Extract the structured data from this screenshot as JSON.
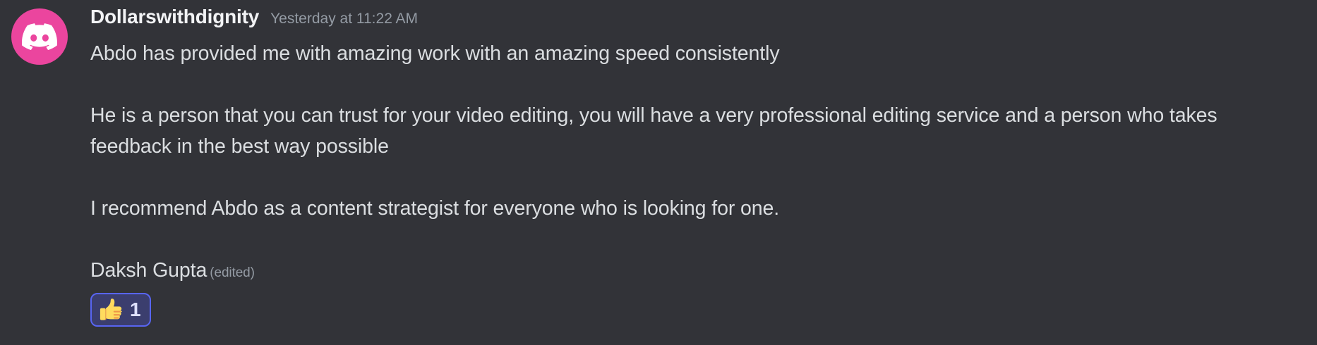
{
  "message": {
    "author": "Dollarswithdignity",
    "timestamp": "Yesterday at 11:22 AM",
    "avatar_icon": "discord-logo-icon",
    "avatar_color": "#eb459e",
    "paragraphs": [
      "Abdo has provided me with amazing work with an amazing speed consistently",
      "",
      "He is a person that you can trust for your video editing, you will have a very professional editing service and a person who takes feedback in the best way possible",
      "",
      "I recommend Abdo as a content strategist for everyone who is looking for one.",
      ""
    ],
    "signature": "Daksh Gupta",
    "edited_label": "(edited)",
    "reactions": [
      {
        "emoji": "thumbs-up-icon",
        "count": "1",
        "accent": "#5865f2"
      }
    ]
  }
}
